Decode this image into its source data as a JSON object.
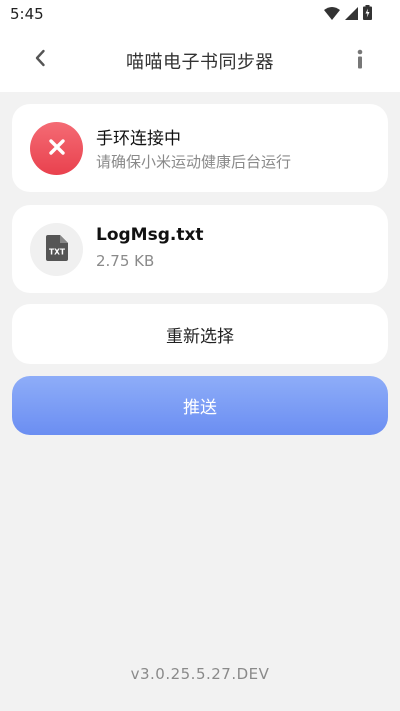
{
  "status_bar": {
    "time": "5:45",
    "icons": [
      "wifi-icon",
      "cellular-signal-icon",
      "battery-charging-icon"
    ]
  },
  "app_bar": {
    "title": "喵喵电子书同步器",
    "back_icon": "chevron-left-icon",
    "info_icon": "info-icon"
  },
  "connection_card": {
    "icon": "close-icon",
    "title": "手环连接中",
    "subtitle": "请确保小米运动健康后台运行",
    "badge_color": "#ee4d59"
  },
  "file_card": {
    "icon": "txt-file-icon",
    "icon_text": "TXT",
    "file_name": "LogMsg.txt",
    "file_size": "2.75 KB"
  },
  "reselect_button": {
    "label": "重新选择"
  },
  "push_button": {
    "label": "推送",
    "color": "#7a9cf5"
  },
  "footer": {
    "version": "v3.0.25.5.27.DEV"
  }
}
